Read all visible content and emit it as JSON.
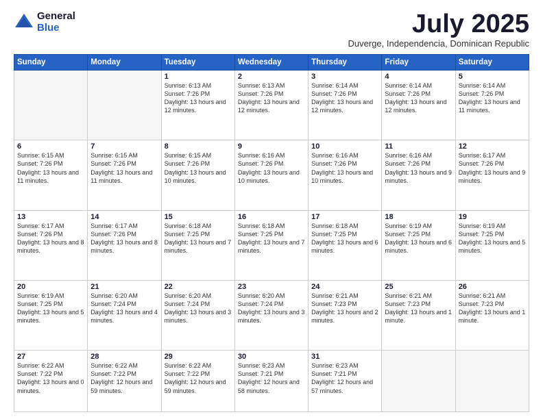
{
  "logo": {
    "general": "General",
    "blue": "Blue"
  },
  "title": "July 2025",
  "subtitle": "Duverge, Independencia, Dominican Republic",
  "days_of_week": [
    "Sunday",
    "Monday",
    "Tuesday",
    "Wednesday",
    "Thursday",
    "Friday",
    "Saturday"
  ],
  "weeks": [
    [
      {
        "day": "",
        "info": ""
      },
      {
        "day": "",
        "info": ""
      },
      {
        "day": "1",
        "info": "Sunrise: 6:13 AM\nSunset: 7:26 PM\nDaylight: 13 hours and 12 minutes."
      },
      {
        "day": "2",
        "info": "Sunrise: 6:13 AM\nSunset: 7:26 PM\nDaylight: 13 hours and 12 minutes."
      },
      {
        "day": "3",
        "info": "Sunrise: 6:14 AM\nSunset: 7:26 PM\nDaylight: 13 hours and 12 minutes."
      },
      {
        "day": "4",
        "info": "Sunrise: 6:14 AM\nSunset: 7:26 PM\nDaylight: 13 hours and 12 minutes."
      },
      {
        "day": "5",
        "info": "Sunrise: 6:14 AM\nSunset: 7:26 PM\nDaylight: 13 hours and 11 minutes."
      }
    ],
    [
      {
        "day": "6",
        "info": "Sunrise: 6:15 AM\nSunset: 7:26 PM\nDaylight: 13 hours and 11 minutes."
      },
      {
        "day": "7",
        "info": "Sunrise: 6:15 AM\nSunset: 7:26 PM\nDaylight: 13 hours and 11 minutes."
      },
      {
        "day": "8",
        "info": "Sunrise: 6:15 AM\nSunset: 7:26 PM\nDaylight: 13 hours and 10 minutes."
      },
      {
        "day": "9",
        "info": "Sunrise: 6:16 AM\nSunset: 7:26 PM\nDaylight: 13 hours and 10 minutes."
      },
      {
        "day": "10",
        "info": "Sunrise: 6:16 AM\nSunset: 7:26 PM\nDaylight: 13 hours and 10 minutes."
      },
      {
        "day": "11",
        "info": "Sunrise: 6:16 AM\nSunset: 7:26 PM\nDaylight: 13 hours and 9 minutes."
      },
      {
        "day": "12",
        "info": "Sunrise: 6:17 AM\nSunset: 7:26 PM\nDaylight: 13 hours and 9 minutes."
      }
    ],
    [
      {
        "day": "13",
        "info": "Sunrise: 6:17 AM\nSunset: 7:26 PM\nDaylight: 13 hours and 8 minutes."
      },
      {
        "day": "14",
        "info": "Sunrise: 6:17 AM\nSunset: 7:26 PM\nDaylight: 13 hours and 8 minutes."
      },
      {
        "day": "15",
        "info": "Sunrise: 6:18 AM\nSunset: 7:25 PM\nDaylight: 13 hours and 7 minutes."
      },
      {
        "day": "16",
        "info": "Sunrise: 6:18 AM\nSunset: 7:25 PM\nDaylight: 13 hours and 7 minutes."
      },
      {
        "day": "17",
        "info": "Sunrise: 6:18 AM\nSunset: 7:25 PM\nDaylight: 13 hours and 6 minutes."
      },
      {
        "day": "18",
        "info": "Sunrise: 6:19 AM\nSunset: 7:25 PM\nDaylight: 13 hours and 6 minutes."
      },
      {
        "day": "19",
        "info": "Sunrise: 6:19 AM\nSunset: 7:25 PM\nDaylight: 13 hours and 5 minutes."
      }
    ],
    [
      {
        "day": "20",
        "info": "Sunrise: 6:19 AM\nSunset: 7:25 PM\nDaylight: 13 hours and 5 minutes."
      },
      {
        "day": "21",
        "info": "Sunrise: 6:20 AM\nSunset: 7:24 PM\nDaylight: 13 hours and 4 minutes."
      },
      {
        "day": "22",
        "info": "Sunrise: 6:20 AM\nSunset: 7:24 PM\nDaylight: 13 hours and 3 minutes."
      },
      {
        "day": "23",
        "info": "Sunrise: 6:20 AM\nSunset: 7:24 PM\nDaylight: 13 hours and 3 minutes."
      },
      {
        "day": "24",
        "info": "Sunrise: 6:21 AM\nSunset: 7:23 PM\nDaylight: 13 hours and 2 minutes."
      },
      {
        "day": "25",
        "info": "Sunrise: 6:21 AM\nSunset: 7:23 PM\nDaylight: 13 hours and 1 minute."
      },
      {
        "day": "26",
        "info": "Sunrise: 6:21 AM\nSunset: 7:23 PM\nDaylight: 13 hours and 1 minute."
      }
    ],
    [
      {
        "day": "27",
        "info": "Sunrise: 6:22 AM\nSunset: 7:22 PM\nDaylight: 13 hours and 0 minutes."
      },
      {
        "day": "28",
        "info": "Sunrise: 6:22 AM\nSunset: 7:22 PM\nDaylight: 12 hours and 59 minutes."
      },
      {
        "day": "29",
        "info": "Sunrise: 6:22 AM\nSunset: 7:22 PM\nDaylight: 12 hours and 59 minutes."
      },
      {
        "day": "30",
        "info": "Sunrise: 6:23 AM\nSunset: 7:21 PM\nDaylight: 12 hours and 58 minutes."
      },
      {
        "day": "31",
        "info": "Sunrise: 6:23 AM\nSunset: 7:21 PM\nDaylight: 12 hours and 57 minutes."
      },
      {
        "day": "",
        "info": ""
      },
      {
        "day": "",
        "info": ""
      }
    ]
  ]
}
